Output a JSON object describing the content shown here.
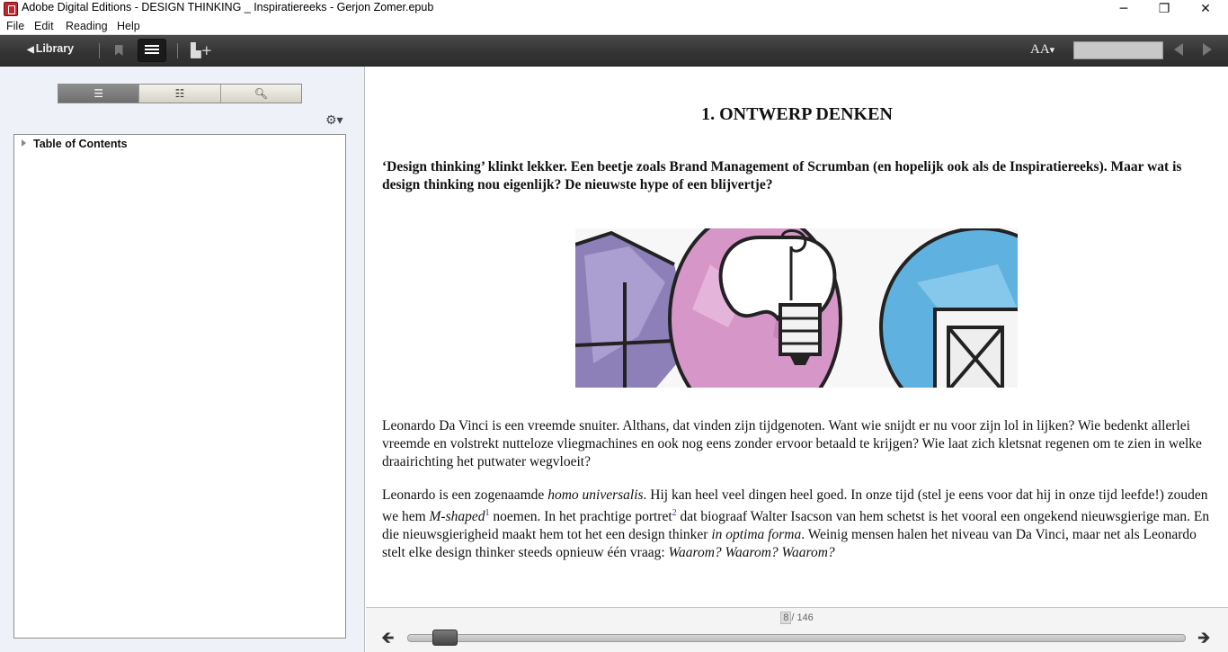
{
  "window": {
    "title": "Adobe Digital Editions - DESIGN THINKING _ Inspiratiereeks - Gerjon Zomer.epub",
    "minimize": "─",
    "maximize": "❐",
    "close": "✕"
  },
  "menu": {
    "file": "File",
    "edit": "Edit",
    "reading": "Reading",
    "help": "Help"
  },
  "toolbar": {
    "library_label": "Library",
    "font_label": "AA",
    "search_value": ""
  },
  "sidebar": {
    "segments": [
      {
        "icon": "toc-icon",
        "active": true
      },
      {
        "icon": "bookmarks-icon",
        "active": false
      },
      {
        "icon": "search-icon",
        "active": false
      }
    ],
    "toc_root": "Table of Contents"
  },
  "content": {
    "chapter_title": "1. ONTWERP DENKEN",
    "intro": "‘Design thinking’ klinkt lekker. Een beetje zoals Brand Management of Scrumban (en hopelijk ook als de Inspiratiereeks). Maar wat is design thinking nou eigenlijk? De nieuwste hype of een blijvertje?",
    "para1": "Leonardo Da Vinci is een vreemde snuiter. Althans, dat vinden zijn tijdgenoten. Want wie snijdt er nu voor zijn lol in lijken? Wie bedenkt allerlei vreemde en volstrekt nutteloze vliegmachines en ook nog eens zonder ervoor betaald te krijgen? Wie laat zich kletsnat regenen om te zien in welke draairichting het putwater wegvloeit?",
    "para2": {
      "p1": "Leonardo is een zogenaamde ",
      "i1": "homo universalis",
      "p2": ". Hij kan heel veel dingen heel goed. In onze tijd (stel je eens voor dat hij in onze tijd leefde!) zouden we hem ",
      "i2": "M-shaped",
      "sup1": "1",
      "p3": " noemen. In het prachtige portret",
      "sup2": "2",
      "p4": " dat biograaf Walter Isacson van hem schetst is het vooral een ongekend nieuwsgierige man. En die nieuwsgierigheid maakt hem tot het een design thinker ",
      "i3": "in optima forma",
      "p5": ". Weinig mensen halen het niveau van Da Vinci, maar net als Leonardo stelt elke design thinker steeds opnieuw één vraag: ",
      "i4": "Waarom? Waarom? Waarom?"
    }
  },
  "pager": {
    "current": "8",
    "total": "/ 146",
    "progress": 0.048
  }
}
